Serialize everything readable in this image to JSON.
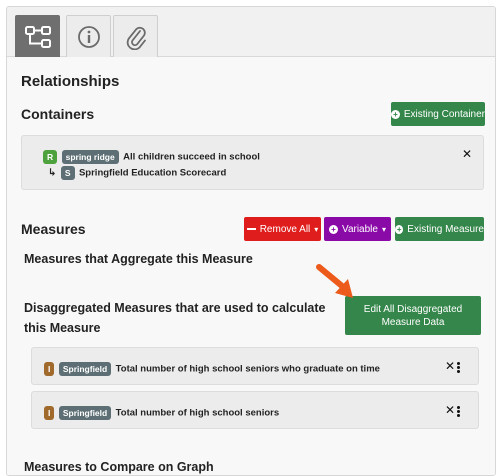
{
  "tabs": [
    {
      "name": "relationships",
      "icon": "network-icon",
      "active": true
    },
    {
      "name": "info",
      "icon": "info-icon",
      "active": false
    },
    {
      "name": "attachments",
      "icon": "paperclip-icon",
      "active": false
    }
  ],
  "page_title": "Relationships",
  "containers": {
    "heading": "Containers",
    "add_button": "Existing Container",
    "items": [
      {
        "badge": "R",
        "tag": "spring ridge",
        "text": "All children succeed in school"
      },
      {
        "badge": "S",
        "text": "Springfield Education Scorecard"
      }
    ]
  },
  "measures": {
    "heading": "Measures",
    "remove_all_button": "Remove All",
    "variable_button": "Variable",
    "existing_measure_button": "Existing Measure",
    "aggregate_heading": "Measures that Aggregate this Measure",
    "disaggregated_heading": "Disaggregated Measures that are used to calculate this Measure",
    "edit_all_button": "Edit All Disaggregated Measure Data",
    "items": [
      {
        "badge": "I",
        "tag": "Springfield",
        "text": "Total number of high school seniors who graduate on time"
      },
      {
        "badge": "I",
        "tag": "Springfield",
        "text": "Total number of high school seniors"
      }
    ],
    "compare_heading": "Measures to Compare on Graph"
  },
  "colors": {
    "green": "#34864a",
    "red": "#e01d1d",
    "purple": "#8a0aa8",
    "arrow": "#ec5a1c"
  }
}
